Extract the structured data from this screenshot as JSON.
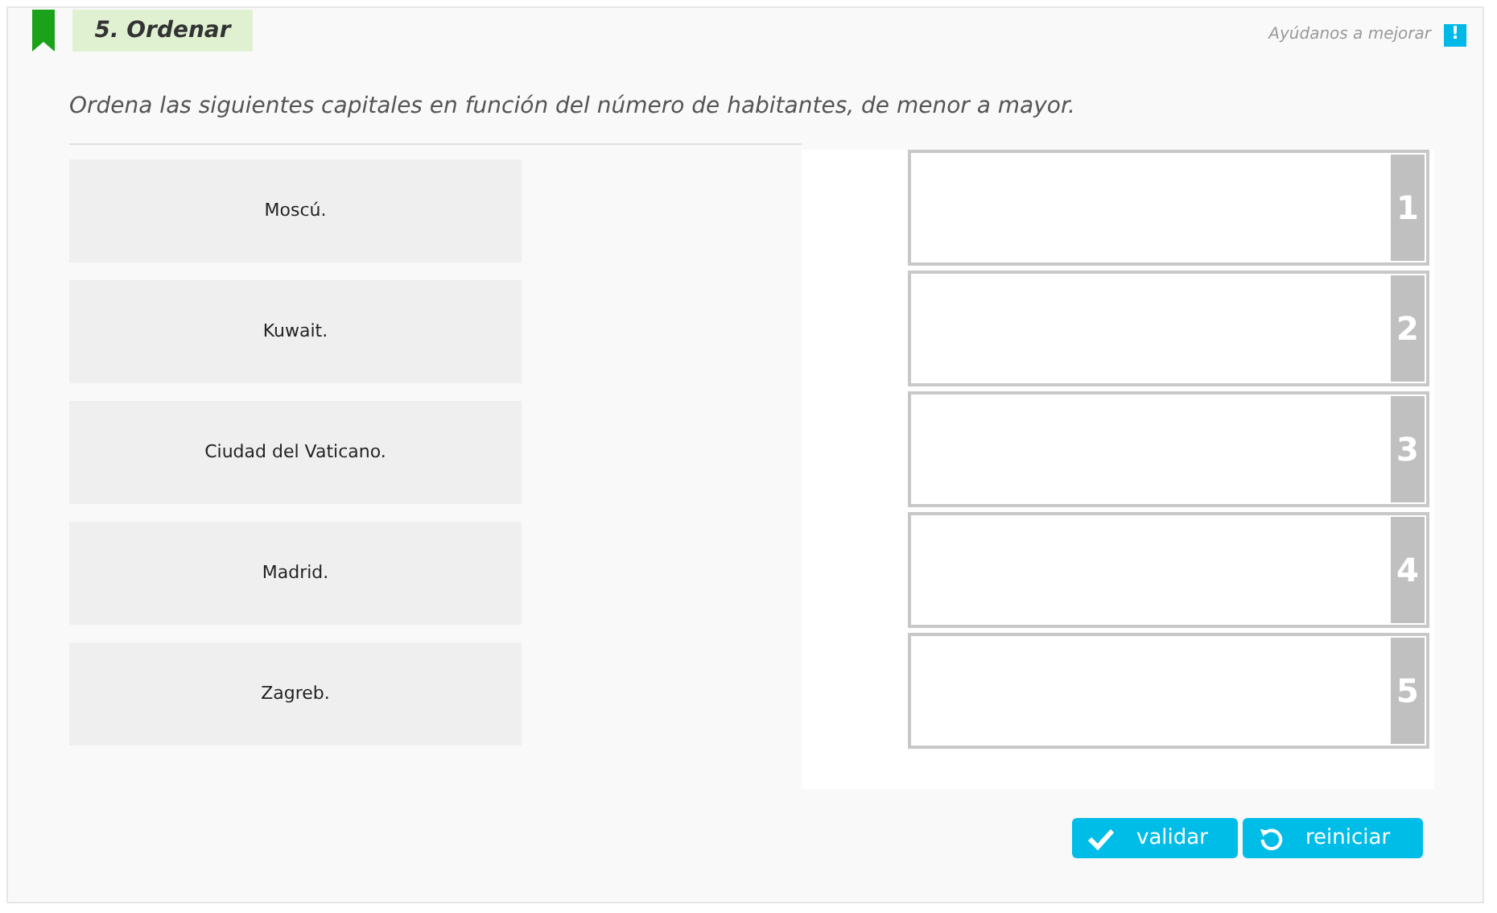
{
  "header": {
    "title": "5. Ordenar",
    "feedback_link": "Ayúdanos a mejorar",
    "feedback_icon": "!"
  },
  "question": "Ordena las siguientes capitales en función del número de habitantes, de menor a mayor.",
  "items": [
    {
      "label": "Moscú."
    },
    {
      "label": "Kuwait."
    },
    {
      "label": "Ciudad del Vaticano."
    },
    {
      "label": "Madrid."
    },
    {
      "label": "Zagreb."
    }
  ],
  "slots": [
    {
      "number": "1"
    },
    {
      "number": "2"
    },
    {
      "number": "3"
    },
    {
      "number": "4"
    },
    {
      "number": "5"
    }
  ],
  "buttons": [
    {
      "kind": "validate",
      "label": "validar"
    },
    {
      "kind": "reset",
      "label": "reiniciar"
    }
  ]
}
